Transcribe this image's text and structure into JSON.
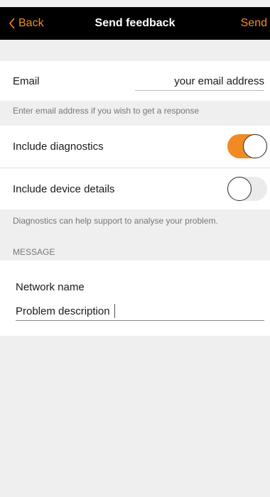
{
  "nav": {
    "back_label": "Back",
    "title": "Send feedback",
    "send_label": "Send"
  },
  "email": {
    "label": "Email",
    "placeholder": "your email address",
    "hint": "Enter email address if you wish to get a response"
  },
  "settings": {
    "diagnostics_label": "Include diagnostics",
    "diagnostics_on": true,
    "device_label": "Include device details",
    "device_on": false,
    "hint": "Diagnostics can help support to analyse your problem."
  },
  "message": {
    "section_header": "MESSAGE",
    "network_label": "Network name",
    "description_placeholder": "Problem description"
  },
  "colors": {
    "accent": "#f28a24",
    "nav_background": "#000000",
    "page_background": "#efefef"
  }
}
